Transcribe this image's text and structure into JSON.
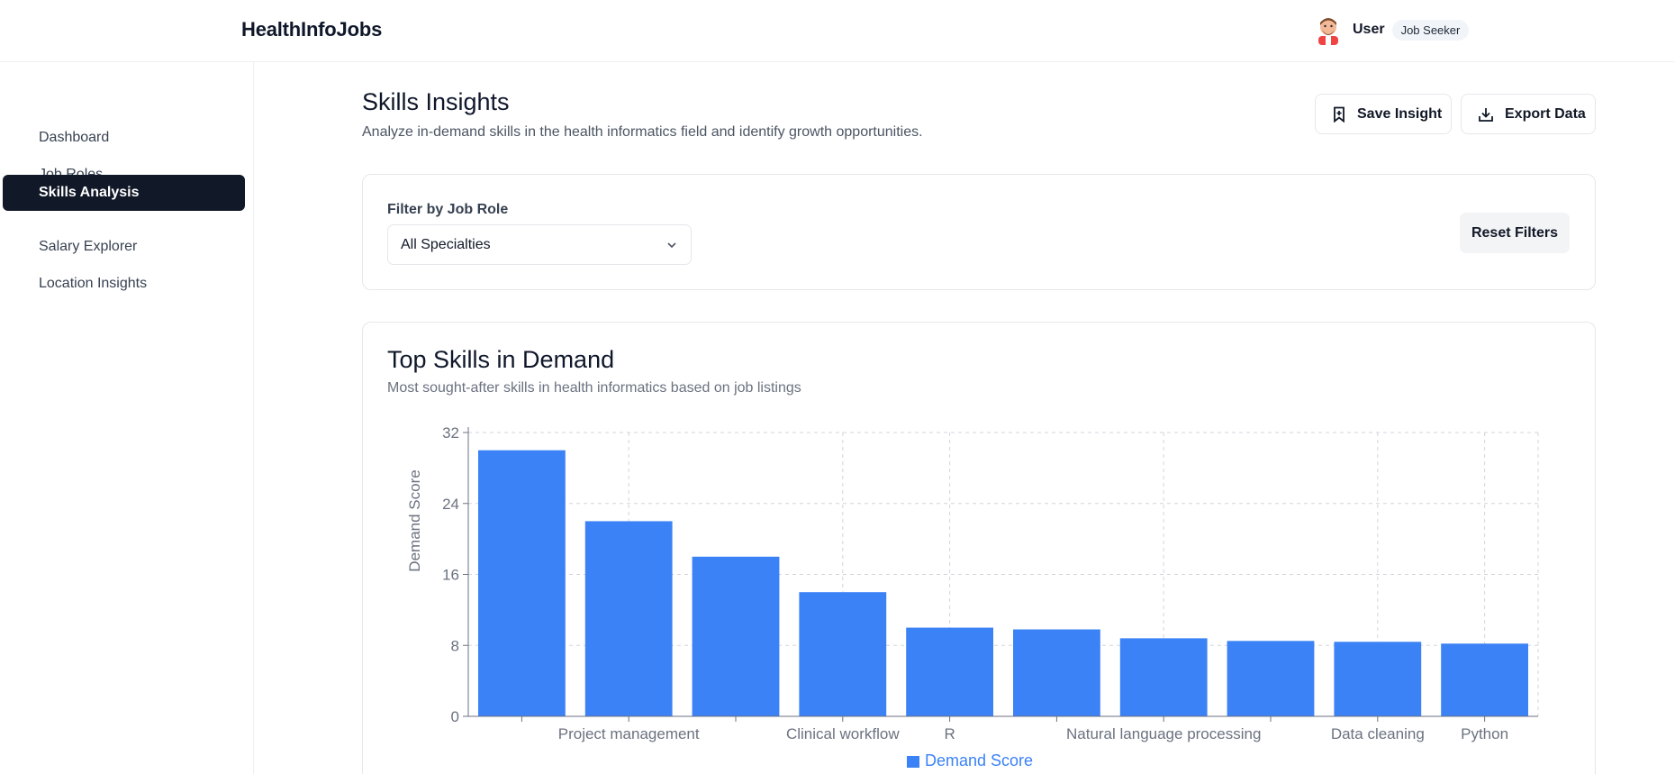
{
  "app": {
    "brand": "HealthInfoJobs"
  },
  "user": {
    "name": "User",
    "role_badge": "Job Seeker"
  },
  "sidebar": {
    "items": [
      {
        "label": "Dashboard",
        "active": false
      },
      {
        "label": "Job Roles",
        "active": false
      },
      {
        "label": "Skills Analysis",
        "active": true
      },
      {
        "label": "Salary Explorer",
        "active": false
      },
      {
        "label": "Location Insights",
        "active": false
      }
    ]
  },
  "page": {
    "title": "Skills Insights",
    "subtitle": "Analyze in-demand skills in the health informatics field and identify growth opportunities."
  },
  "actions": {
    "save_label": "Save Insight",
    "export_label": "Export Data"
  },
  "filter": {
    "label": "Filter by Job Role",
    "selected": "All Specialties",
    "reset_label": "Reset Filters"
  },
  "chart_card": {
    "title": "Top Skills in Demand",
    "subtitle": "Most sought-after skills in health informatics based on job listings"
  },
  "colors": {
    "bar": "#3b82f6",
    "active_nav": "#111827"
  },
  "chart_data": {
    "type": "bar",
    "categories": [
      "",
      "Project management",
      "",
      "Clinical workflow",
      "R",
      "",
      "Natural language processing",
      "",
      "Data cleaning",
      "Python"
    ],
    "values": [
      30,
      22,
      18,
      14,
      10,
      9.8,
      8.8,
      8.5,
      8.4,
      8.2
    ],
    "ylabel": "Demand Score",
    "xlabel": "",
    "yticks": [
      0,
      8,
      16,
      24,
      32
    ],
    "ylim": [
      0,
      32
    ],
    "series": [
      {
        "name": "Demand Score",
        "color": "#3b82f6"
      }
    ],
    "grid": true,
    "legend": "bottom"
  }
}
